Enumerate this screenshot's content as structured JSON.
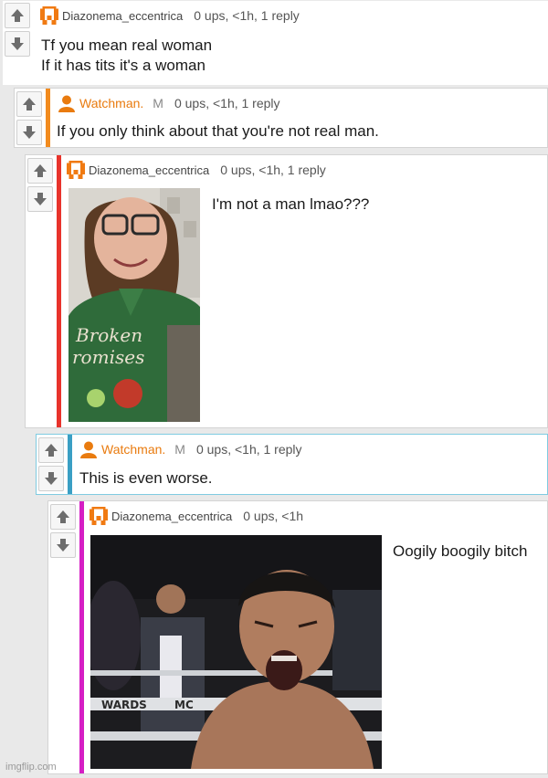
{
  "comments": [
    {
      "username": "Diazonema_eccentrica",
      "meta": "0 ups, <1h, 1 reply",
      "text": "Tf you mean real woman\nIf it has tits it's a woman"
    },
    {
      "username": "Watchman.",
      "mod_flag": "M",
      "meta": "0 ups, <1h, 1 reply",
      "text": "If you only think about that you're not real man."
    },
    {
      "username": "Diazonema_eccentrica",
      "meta": "0 ups, <1h, 1 reply",
      "text": "I'm not a man lmao???",
      "image": {
        "shirt_text_1": "Broken",
        "shirt_text_2": "romises"
      }
    },
    {
      "username": "Watchman.",
      "mod_flag": "M",
      "meta": "0 ups, <1h, 1 reply",
      "text": "This is even worse."
    },
    {
      "username": "Diazonema_eccentrica",
      "meta": "0 ups, <1h",
      "text": "Oogily boogily bitch",
      "image": {
        "banner_text_1": "WARDS",
        "banner_text_2": "MC"
      }
    }
  ],
  "colors": {
    "thread_l2": "#f28b1e",
    "thread_l3": "#e8332b",
    "thread_l4": "#3a9fc4",
    "thread_l5": "#d51ec4",
    "accent_user": "#e97b0f"
  },
  "watermark": "imgflip.com"
}
